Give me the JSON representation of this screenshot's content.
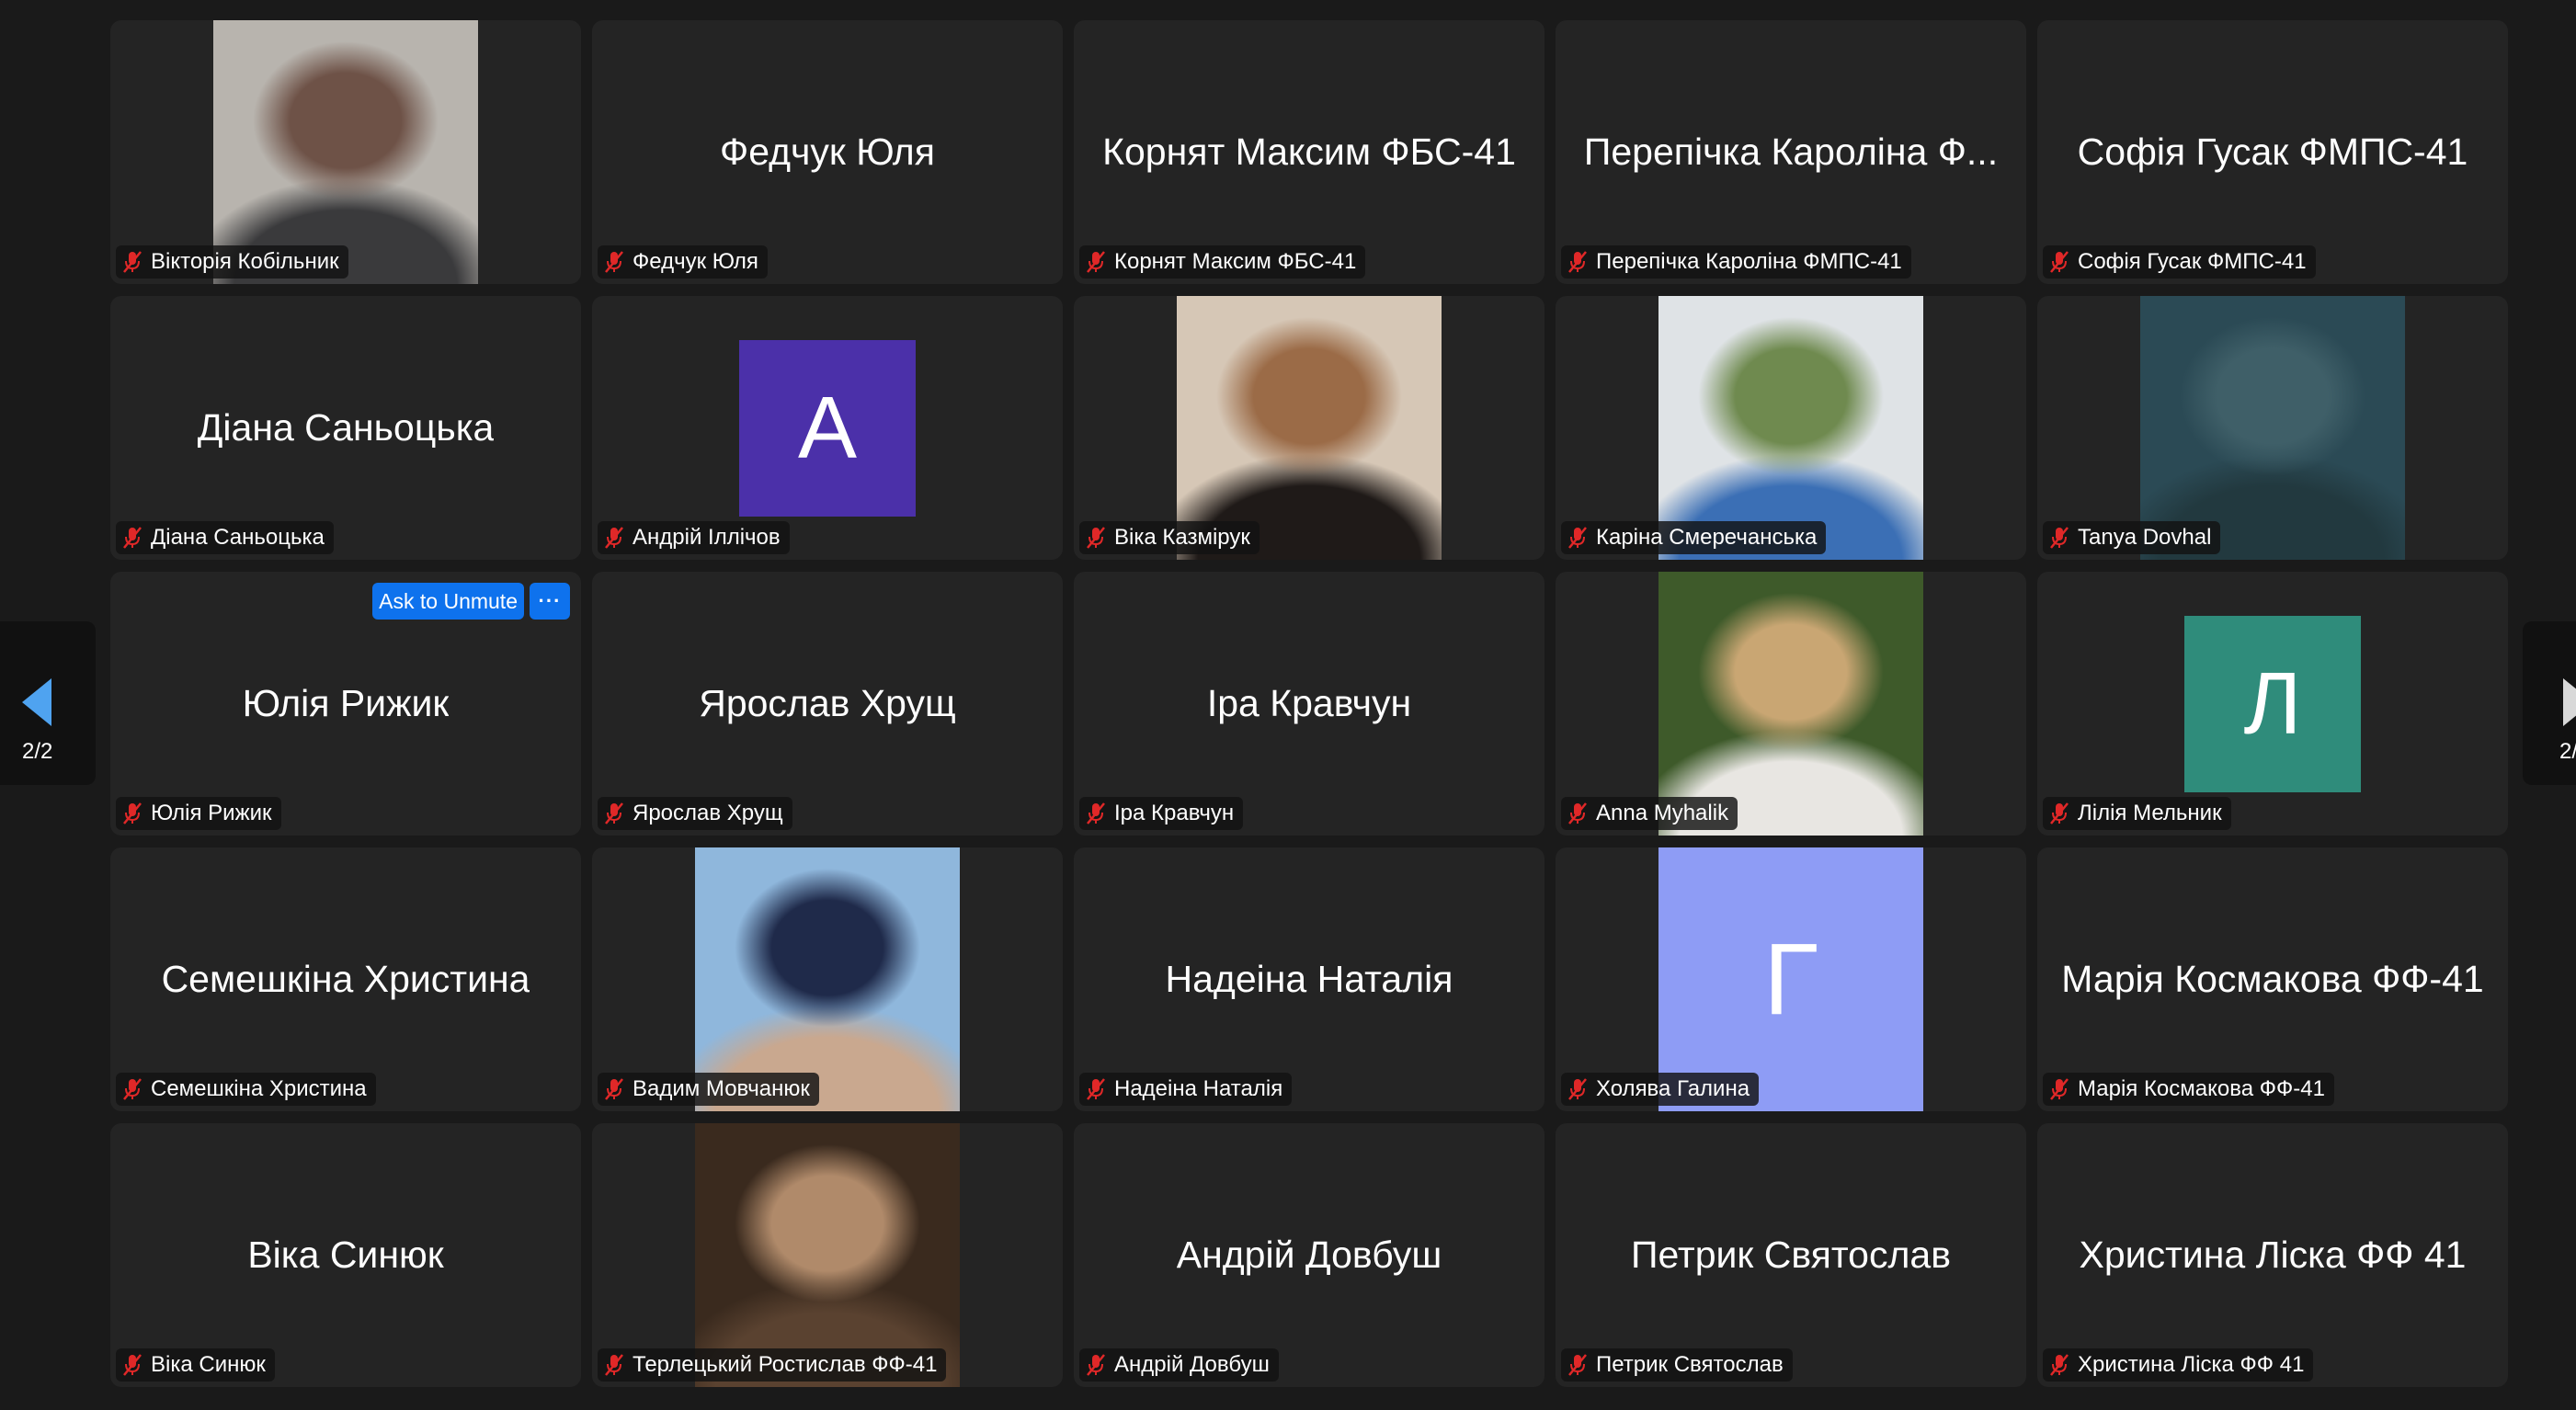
{
  "participants": [
    {
      "name": "Вікторія Кобільник",
      "tile_label": "",
      "tile_type": "photo",
      "photo_colors": [
        "#b8b4ae",
        "#6e5247",
        "#3a3a3c"
      ]
    },
    {
      "name": "Федчук Юля",
      "tile_label": "Федчук Юля",
      "tile_type": "text"
    },
    {
      "name": "Корнят Максим ФБС-41",
      "tile_label": "Корнят Максим ФБС-41",
      "tile_type": "text"
    },
    {
      "name": "Перепічка Кароліна ФМПС-41",
      "tile_label": "Перепічка Кароліна Ф...",
      "tile_type": "text"
    },
    {
      "name": "Софія Гусак ФМПС-41",
      "tile_label": "Софія Гусак ФМПС-41",
      "tile_type": "text"
    },
    {
      "name": "Діана Саньоцька",
      "tile_label": "Діана Саньоцька",
      "tile_type": "text"
    },
    {
      "name": "Андрій Іллічов",
      "tile_label": "",
      "tile_type": "avatar",
      "avatar_letter": "A",
      "avatar_color": "#4b30a9"
    },
    {
      "name": "Віка Казмірук",
      "tile_label": "",
      "tile_type": "photo",
      "photo_colors": [
        "#d6c7b6",
        "#9b6b47",
        "#1f1a18"
      ]
    },
    {
      "name": "Каріна Смеречанська",
      "tile_label": "",
      "tile_type": "photo",
      "photo_colors": [
        "#dfe3e6",
        "#6f8a4f",
        "#3b6fb5"
      ]
    },
    {
      "name": "Tanya Dovhal",
      "tile_label": "",
      "tile_type": "photo",
      "photo_colors": [
        "#2b4a55",
        "#3f5f68",
        "#22393f"
      ]
    },
    {
      "name": "Юлія Рижик",
      "tile_label": "Юлія Рижик",
      "tile_type": "text",
      "hover_controls": true
    },
    {
      "name": "Ярослав Хрущ",
      "tile_label": "Ярослав Хрущ",
      "tile_type": "text"
    },
    {
      "name": "Іра Кравчун",
      "tile_label": "Іра Кравчун",
      "tile_type": "text"
    },
    {
      "name": "Anna Myhalik",
      "tile_label": "",
      "tile_type": "photo",
      "photo_colors": [
        "#3e5a2a",
        "#c9a673",
        "#e8e6e2"
      ]
    },
    {
      "name": "Лілія Мельник",
      "tile_label": "",
      "tile_type": "avatar",
      "avatar_letter": "Л",
      "avatar_color": "#2f8c7b"
    },
    {
      "name": "Семешкіна Христина",
      "tile_label": "Семешкіна Христина",
      "tile_type": "text"
    },
    {
      "name": "Вадим Мовчанюк",
      "tile_label": "",
      "tile_type": "photo",
      "photo_colors": [
        "#8fb7dc",
        "#1f2a4a",
        "#c9a88f"
      ]
    },
    {
      "name": "Надеіна Наталія",
      "tile_label": "Надеіна Наталія",
      "tile_type": "text"
    },
    {
      "name": "Холява Галина",
      "tile_label": "",
      "tile_type": "avatar_wide",
      "avatar_letter": "Г",
      "avatar_color": "#8e9cf5"
    },
    {
      "name": "Марія Космакова ФФ-41",
      "tile_label": "Марія Космакова ФФ-41",
      "tile_type": "text"
    },
    {
      "name": "Віка Синюк",
      "tile_label": "Віка Синюк",
      "tile_type": "text"
    },
    {
      "name": "Терлецький Ростислав ФФ-41",
      "tile_label": "",
      "tile_type": "photo",
      "photo_colors": [
        "#3a2a1e",
        "#b08a6a",
        "#5a4230"
      ]
    },
    {
      "name": "Андрій Довбуш",
      "tile_label": "Андрій Довбуш",
      "tile_type": "text"
    },
    {
      "name": "Петрик Святослав",
      "tile_label": "Петрик Святослав",
      "tile_type": "text"
    },
    {
      "name": "Христина Ліска ФФ 41",
      "tile_label": "Христина Ліска ФФ 41",
      "tile_type": "text"
    }
  ],
  "hover_controls": {
    "ask_to_unmute_label": "Ask to Unmute",
    "more_label": "···"
  },
  "pagination": {
    "left_label": "2/2",
    "right_label": "2/"
  },
  "colors": {
    "background": "#1a1a1a",
    "tile": "#242424",
    "accent": "#0e72ed",
    "muted_icon": "#e02828"
  }
}
